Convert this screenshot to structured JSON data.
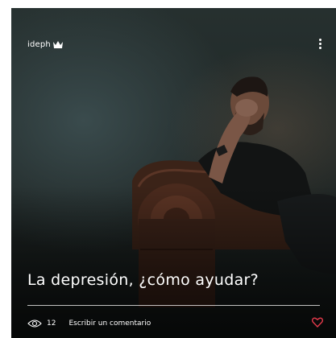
{
  "post": {
    "author": "ideph",
    "title": "La depresión, ¿cómo ayudar?",
    "views": "12",
    "comment_label": "Escribir un comentario"
  },
  "icons": {
    "badge": "crown-icon",
    "menu": "more-vertical-icon",
    "views": "eye-icon",
    "like": "heart-icon"
  },
  "colors": {
    "text": "#ffffff",
    "like": "#e0394a",
    "background": "#1f2625"
  }
}
